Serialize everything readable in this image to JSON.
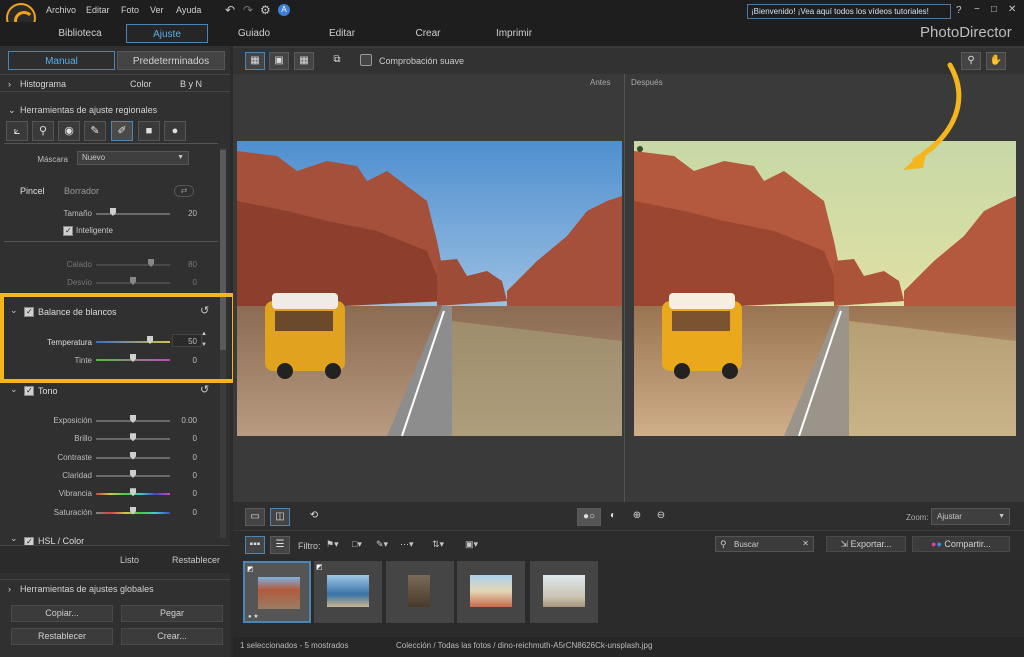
{
  "menu": {
    "items": [
      "Archivo",
      "Editar",
      "Foto",
      "Ver",
      "Ayuda"
    ]
  },
  "welcome": "¡Bienvenido! ¡Vea aquí todos los vídeos tutoriales!",
  "window_controls": {
    "help": "?",
    "minimize": "−",
    "restore": "□",
    "close": "✕"
  },
  "nav": {
    "tabs": [
      "Biblioteca",
      "Ajuste",
      "Guiado",
      "Editar",
      "Crear",
      "Imprimir"
    ],
    "active": "Ajuste"
  },
  "brand": "PhotoDirector",
  "panel_tabs": {
    "manual": "Manual",
    "presets": "Predeterminados"
  },
  "histogram": {
    "label": "Histograma",
    "color": "Color",
    "bw": "B y N"
  },
  "regional": {
    "label": "Herramientas de ajuste regionales"
  },
  "mask": {
    "label": "Máscara",
    "value": "Nuevo"
  },
  "brush": {
    "brush": "Pincel",
    "eraser": "Borrador",
    "size_label": "Tamaño",
    "size_value": "20",
    "smart": "Inteligente",
    "feather_label": "Calado",
    "feather_value": "80",
    "flow_label": "Desvío",
    "flow_value": "0"
  },
  "wb": {
    "label": "Balance de blancos",
    "temp_label": "Temperatura",
    "temp_value": "50",
    "tint_label": "Tinte",
    "tint_value": "0"
  },
  "tone": {
    "label": "Tono",
    "rows": [
      {
        "label": "Exposición",
        "value": "0.00"
      },
      {
        "label": "Brillo",
        "value": "0"
      },
      {
        "label": "Contraste",
        "value": "0"
      },
      {
        "label": "Claridad",
        "value": "0"
      },
      {
        "label": "Vibrancia",
        "value": "0"
      },
      {
        "label": "Saturación",
        "value": "0"
      }
    ]
  },
  "hsl": {
    "label": "HSL / Color"
  },
  "panel_actions": {
    "done": "Listo",
    "reset": "Restablecer"
  },
  "global": {
    "label": "Herramientas de ajustes globales"
  },
  "buttons": {
    "copy": "Copiar...",
    "paste": "Pegar",
    "reset": "Restablecer",
    "create": "Crear..."
  },
  "viewer": {
    "soft_proof": "Comprobación suave",
    "before": "Antes",
    "after": "Después",
    "zoom_label": "Zoom:",
    "zoom_value": "Ajustar"
  },
  "filmstrip": {
    "filter": "Filtro:",
    "search_placeholder": "Buscar",
    "export": "Exportar...",
    "share": "Compartir..."
  },
  "status": {
    "count": "1 seleccionados - 5 mostrados",
    "path": "Colección / Todas las fotos / dino-reichmuth-A5rCN8626Ck-unsplash.jpg"
  },
  "colors": {
    "accent": "#4a87b8",
    "highlight": "#f5b51c",
    "arrow": "#f5b51c"
  }
}
